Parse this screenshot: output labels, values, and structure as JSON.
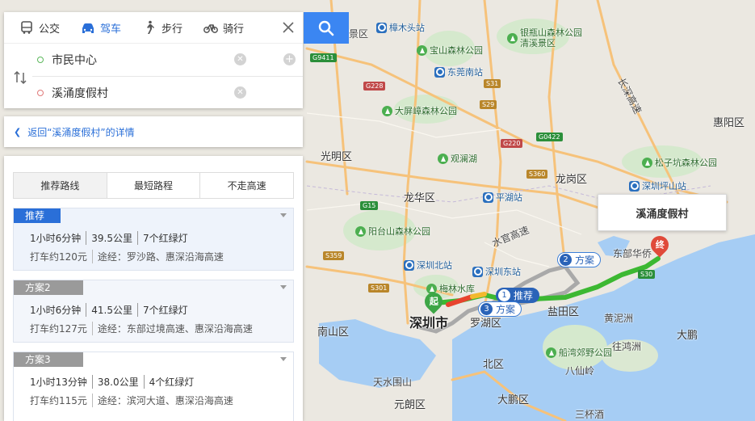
{
  "mode_tabs": [
    {
      "label": "公交",
      "icon": "bus-icon"
    },
    {
      "label": "驾车",
      "icon": "car-icon",
      "active": true
    },
    {
      "label": "步行",
      "icon": "walk-icon"
    },
    {
      "label": "骑行",
      "icon": "bike-icon"
    }
  ],
  "route_inputs": {
    "origin": "市民中心",
    "destination": "溪涌度假村"
  },
  "back_link": "返回“溪涌度假村”的详情",
  "preference_tabs": [
    "推荐路线",
    "最短路程",
    "不走高速"
  ],
  "plans": [
    {
      "badge": "推荐",
      "duration": "1小时6分钟",
      "distance": "39.5公里",
      "lights": "7个红绿灯",
      "taxi": "打车约120元",
      "via": "途经：罗沙路、惠深沿海高速"
    },
    {
      "badge": "方案2",
      "duration": "1小时6分钟",
      "distance": "41.5公里",
      "lights": "7个红绿灯",
      "taxi": "打车约127元",
      "via": "途经：东部过境高速、惠深沿海高速"
    },
    {
      "badge": "方案3",
      "duration": "1小时13分钟",
      "distance": "38.0公里",
      "lights": "4个红绿灯",
      "taxi": "打车约115元",
      "via": "途经：滨河大道、惠深沿海高速"
    }
  ],
  "map": {
    "destination_popup": "溪涌度假村",
    "start_marker": "起",
    "end_marker": "终",
    "route_tags": [
      {
        "num": "1",
        "label": "推荐"
      },
      {
        "num": "2",
        "label": "方案"
      },
      {
        "num": "3",
        "label": "方案"
      }
    ],
    "districts": [
      "光明区",
      "龙华区",
      "龙岗区",
      "惠阳区",
      "盐田区",
      "南山区",
      "罗湖区",
      "北区",
      "大鹏",
      "大鹏区",
      "元朗区",
      "深圳市"
    ],
    "places": [
      "东莞南站",
      "坪山站",
      "深圳北站",
      "深圳东站",
      "平湖站",
      "深圳坪山站",
      "樟木头站",
      "东部华侨",
      "黄泥洲",
      "往鸿洲",
      "八仙岭",
      "天水围山",
      "三杯酒",
      "景区",
      "长深高速",
      "水官高速",
      "清溪"
    ],
    "parks": [
      "宝山森林公园",
      "银瓶山森林公园清溪景区",
      "大屏嶂森林公园",
      "观澜湖",
      "松子坑森林公园",
      "阳台山森林公园",
      "梅林水库",
      "船湾郊野公园"
    ],
    "shields": [
      "G9411",
      "G228",
      "S29",
      "G0422",
      "G15",
      "S359",
      "S360",
      "S301",
      "G220",
      "S30",
      "S31"
    ],
    "colors": {
      "route_main": "#3cb832",
      "route_alt": "#a9a9a9",
      "sea": "#a6cdf4",
      "accent": "#2a6fd8"
    }
  }
}
